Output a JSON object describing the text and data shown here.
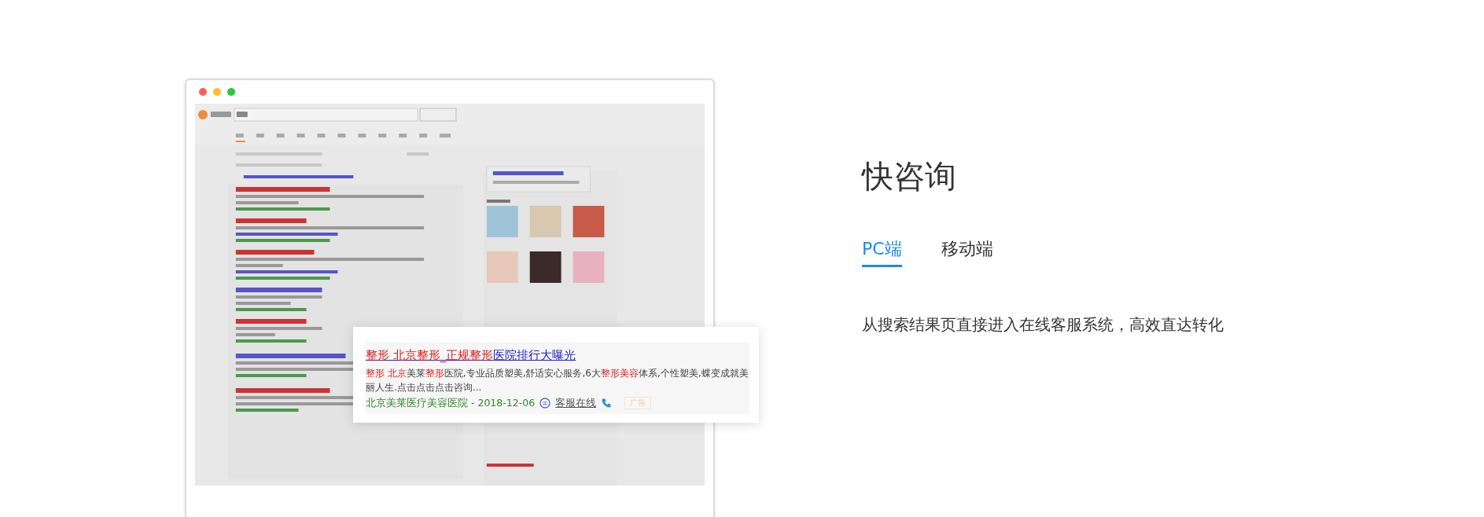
{
  "mockup": {
    "popup": {
      "title": [
        {
          "text": "整形 北京整形_正规整形",
          "highlight": true
        },
        {
          "text": "医院排行大曝光",
          "highlight": false
        }
      ],
      "description": [
        {
          "text": "整形 北京",
          "highlight": true
        },
        {
          "text": "美莱",
          "highlight": false
        },
        {
          "text": "整形",
          "highlight": true
        },
        {
          "text": "医院,专业品质塑美,舒适安心服务,6大",
          "highlight": false
        },
        {
          "text": "整形美容",
          "highlight": true
        },
        {
          "text": "体系,个性塑美,蝶变成就美丽人生.点击点击点击咨询...",
          "highlight": false
        }
      ],
      "source": "北京美莱医疗美容医院 - 2018-12-06",
      "chat_link": "客服在线",
      "ad_badge": "广告"
    }
  },
  "feature": {
    "title": "快咨询",
    "tabs": [
      {
        "label": "PC端",
        "selected": true
      },
      {
        "label": "移动端",
        "selected": false
      }
    ],
    "description": "从搜索结果页直接进入在线客服系统，高效直达转化"
  }
}
